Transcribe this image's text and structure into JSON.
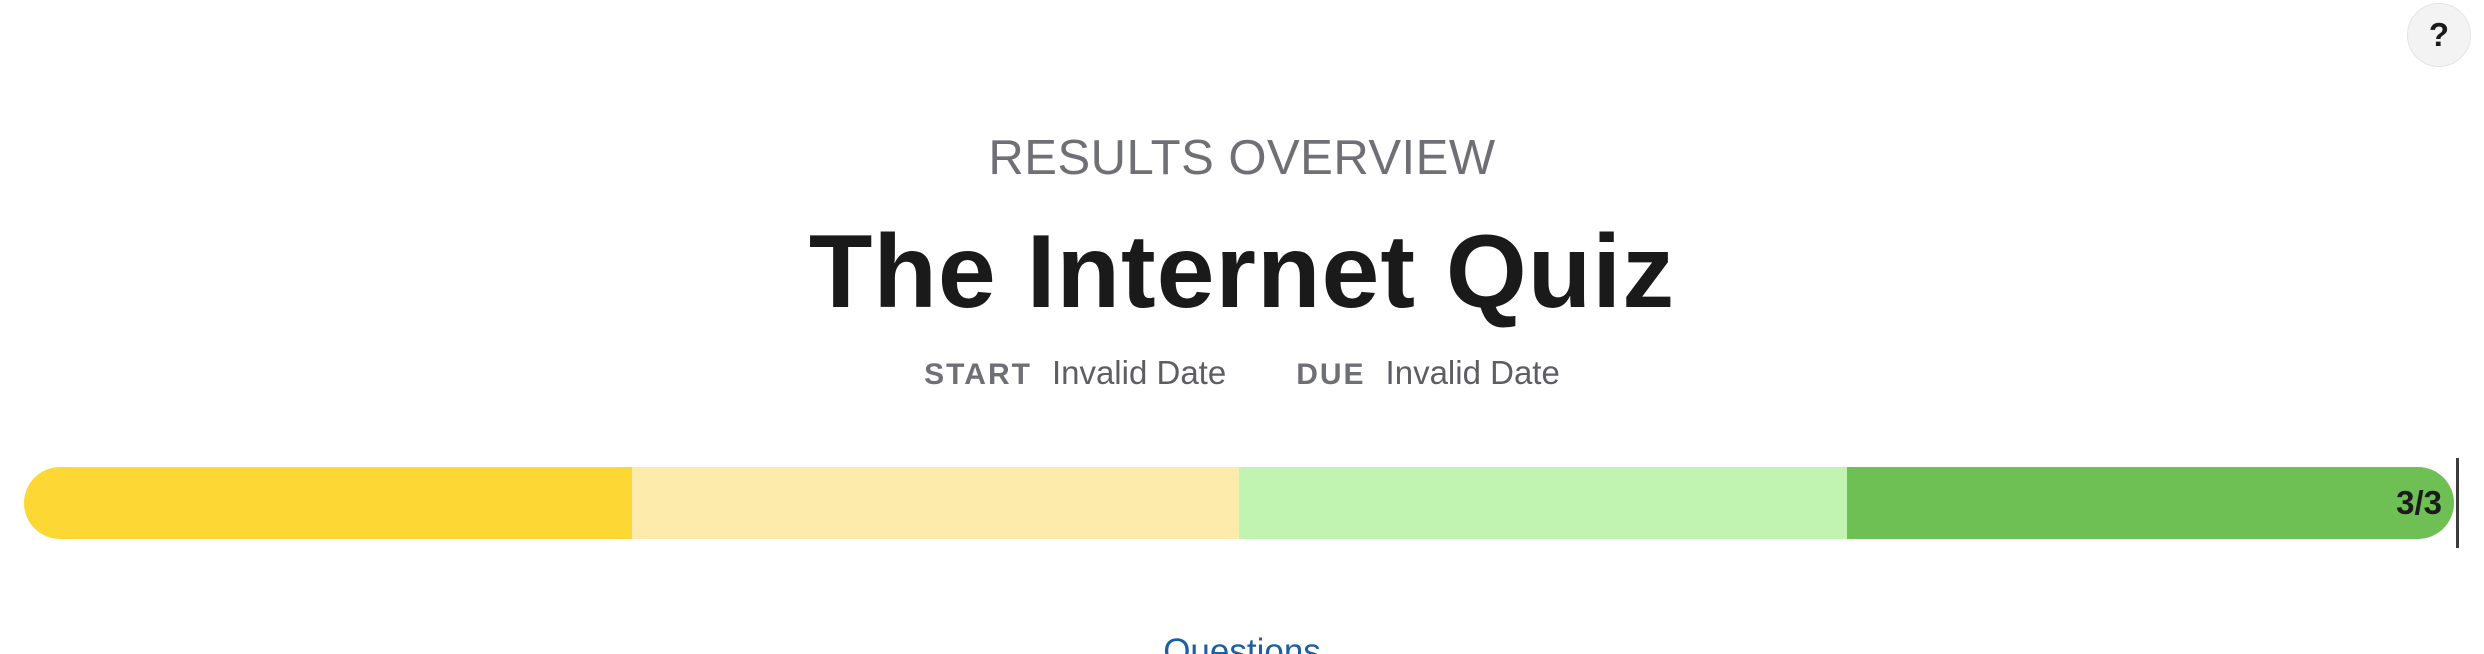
{
  "help": {
    "label": "?",
    "icon": "help-icon"
  },
  "header": {
    "eyebrow": "RESULTS OVERVIEW",
    "title": "The Internet Quiz"
  },
  "dates": {
    "start_label": "START",
    "start_value": "Invalid Date",
    "due_label": "DUE",
    "due_value": "Invalid Date"
  },
  "progress": {
    "count": "3/3",
    "completed": 3,
    "total": 3,
    "segment_colors": [
      "#fdd835",
      "#fcebaa",
      "#c1f4b0",
      "#6ebf54"
    ]
  },
  "nav": {
    "questions_link": "Questions"
  }
}
